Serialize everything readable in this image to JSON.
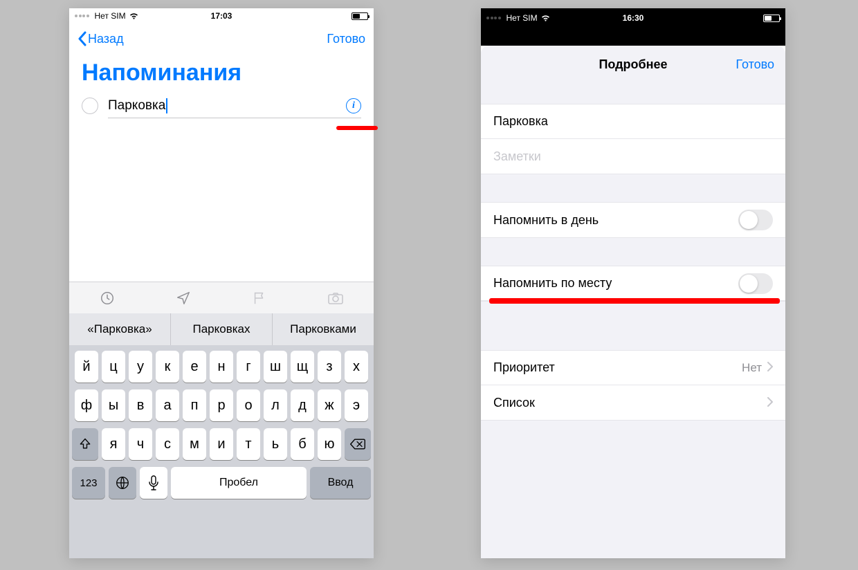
{
  "left": {
    "status": {
      "carrier": "Нет SIM",
      "time": "17:03"
    },
    "nav": {
      "back": "Назад",
      "done": "Готово"
    },
    "title": "Напоминания",
    "reminder_text": "Парковка",
    "suggestions": [
      "«Парковка»",
      "Парковках",
      "Парковками"
    ],
    "keyboard": {
      "row1": [
        "й",
        "ц",
        "у",
        "к",
        "е",
        "н",
        "г",
        "ш",
        "щ",
        "з",
        "х"
      ],
      "row2": [
        "ф",
        "ы",
        "в",
        "а",
        "п",
        "р",
        "о",
        "л",
        "д",
        "ж",
        "э"
      ],
      "row3": [
        "я",
        "ч",
        "с",
        "м",
        "и",
        "т",
        "ь",
        "б",
        "ю"
      ],
      "numkey": "123",
      "space": "Пробел",
      "return": "Ввод"
    }
  },
  "right": {
    "status": {
      "carrier": "Нет SIM",
      "time": "16:30"
    },
    "sheet": {
      "title": "Подробнее",
      "done": "Готово",
      "reminder_title": "Парковка",
      "notes_placeholder": "Заметки",
      "remind_day": "Напомнить в день",
      "remind_location": "Напомнить по месту",
      "priority_label": "Приоритет",
      "priority_value": "Нет",
      "list_label": "Список"
    }
  }
}
